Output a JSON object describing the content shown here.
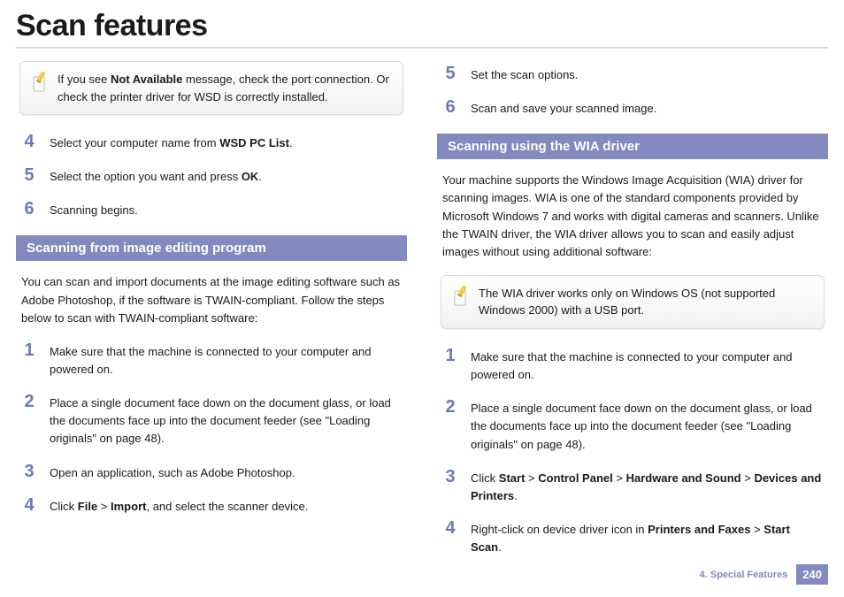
{
  "title": "Scan features",
  "left": {
    "note_parts": [
      "If you see ",
      "Not Available",
      " message, check the port connection. Or check the printer driver for WSD is correctly installed."
    ],
    "top_steps": [
      {
        "n": "4",
        "parts": [
          "Select your computer name from ",
          "WSD PC List",
          "."
        ]
      },
      {
        "n": "5",
        "parts": [
          "Select the option you want and press ",
          "OK",
          "."
        ]
      },
      {
        "n": "6",
        "parts": [
          "Scanning begins."
        ]
      }
    ],
    "section_heading": "Scanning from image editing program",
    "intro": "You can scan and import documents at the image editing software such as Adobe Photoshop, if the software is TWAIN-compliant. Follow the steps below to scan with TWAIN-compliant software:",
    "steps": [
      {
        "n": "1",
        "parts": [
          "Make sure that the machine is connected to your computer and powered on."
        ]
      },
      {
        "n": "2",
        "parts": [
          "Place a single document face down on the document glass, or load the documents face up into the document feeder (see \"Loading originals\" on page 48)."
        ]
      },
      {
        "n": "3",
        "parts": [
          "Open an application, such as Adobe Photoshop."
        ]
      },
      {
        "n": "4",
        "parts": [
          "Click ",
          "File",
          " > ",
          "Import",
          ", and select the scanner device."
        ]
      }
    ]
  },
  "right": {
    "top_steps": [
      {
        "n": "5",
        "parts": [
          "Set the scan options."
        ]
      },
      {
        "n": "6",
        "parts": [
          "Scan and save your scanned image."
        ]
      }
    ],
    "section_heading": "Scanning using the WIA driver",
    "intro": "Your machine supports the Windows Image Acquisition (WIA) driver for scanning images. WIA is one of the standard components provided by Microsoft Windows 7 and works with digital cameras and scanners. Unlike the TWAIN driver, the WIA driver allows you to scan and easily adjust images without using additional software:",
    "note": "The WIA driver works only on Windows OS (not supported Windows 2000) with a USB port.",
    "steps": [
      {
        "n": "1",
        "parts": [
          "Make sure that the machine is connected to your computer and powered on."
        ]
      },
      {
        "n": "2",
        "parts": [
          "Place a single document face down on the document glass, or load the documents face up into the document feeder (see \"Loading originals\" on page 48)."
        ]
      },
      {
        "n": "3",
        "parts": [
          "Click ",
          "Start",
          " > ",
          "Control Panel",
          " > ",
          "Hardware and Sound",
          " > ",
          "Devices and Printers",
          "."
        ]
      },
      {
        "n": "4",
        "parts": [
          "Right-click on device driver icon in ",
          "Printers and Faxes",
          " > ",
          "Start Scan",
          "."
        ]
      }
    ]
  },
  "footer": {
    "chapter": "4.  Special Features",
    "page": "240"
  }
}
